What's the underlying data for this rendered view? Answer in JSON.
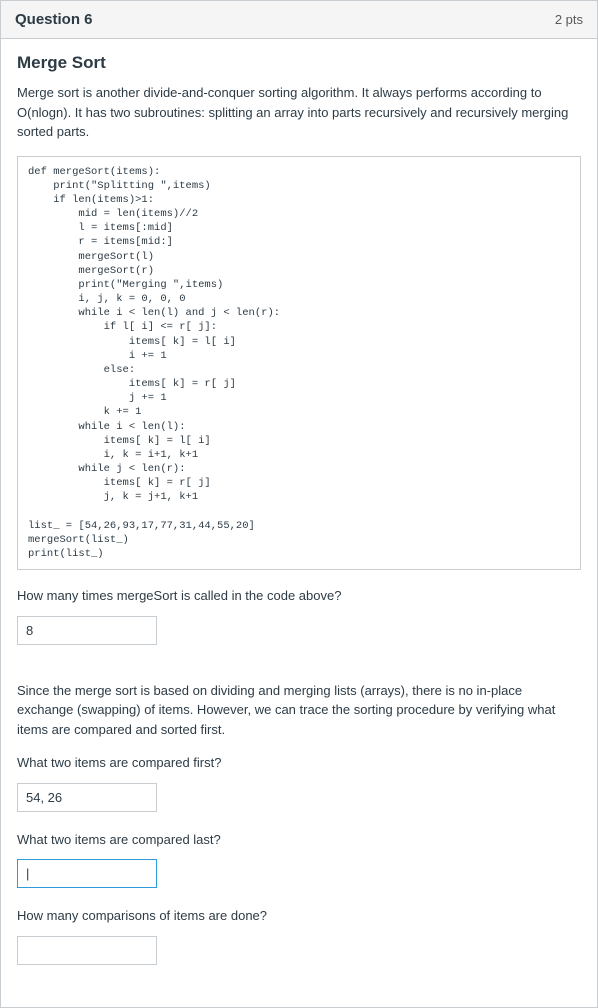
{
  "header": {
    "title": "Question 6",
    "points": "2 pts"
  },
  "section_title": "Merge Sort",
  "intro": "Merge sort is another divide-and-conquer sorting algorithm. It always performs according to O(nlogn). It has two subroutines: splitting an array into parts recursively and recursively merging sorted parts.",
  "code": "def mergeSort(items):\n    print(\"Splitting \",items)\n    if len(items)>1:\n        mid = len(items)//2\n        l = items[:mid]\n        r = items[mid:]\n        mergeSort(l)\n        mergeSort(r)\n        print(\"Merging \",items)\n        i, j, k = 0, 0, 0\n        while i < len(l) and j < len(r):\n            if l[ i] <= r[ j]:\n                items[ k] = l[ i]\n                i += 1\n            else:\n                items[ k] = r[ j]\n                j += 1\n            k += 1\n        while i < len(l):\n            items[ k] = l[ i]\n            i, k = i+1, k+1\n        while j < len(r):\n            items[ k] = r[ j]\n            j, k = j+1, k+1\n\nlist_ = [54,26,93,17,77,31,44,55,20]\nmergeSort(list_)\nprint(list_)",
  "q1": {
    "text": "How many times mergeSort is called in the code above?",
    "value": "8"
  },
  "explain": "Since the merge sort is based on dividing and merging lists (arrays), there is no in-place exchange (swapping) of items. However, we can trace the sorting procedure by verifying what items are compared and sorted first.",
  "q2": {
    "text": "What two items are compared first?",
    "value": "54, 26"
  },
  "q3": {
    "text": "What two items are compared last?",
    "value": "|"
  },
  "q4": {
    "text": "How many comparisons of items are done?",
    "value": ""
  }
}
